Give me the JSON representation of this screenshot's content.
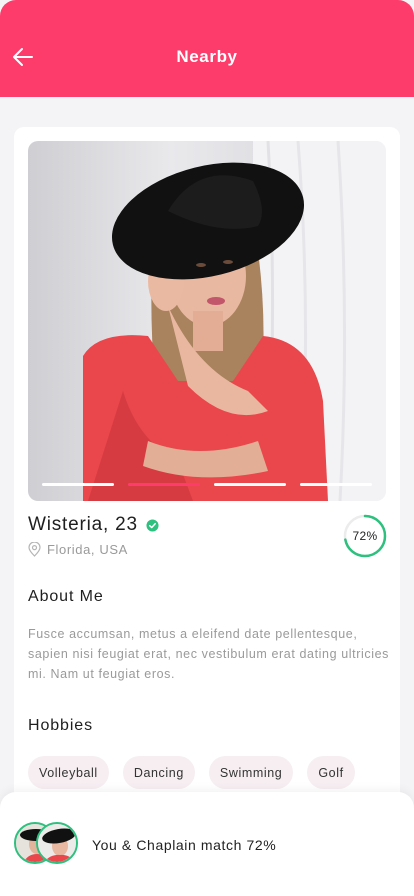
{
  "header": {
    "title": "Nearby",
    "back_icon": "arrow-left-icon",
    "background": "#fd3c6b"
  },
  "profile": {
    "name": "Wisteria, 23",
    "verified_icon": "verified-check-icon",
    "location": "Florida, USA",
    "location_icon": "map-pin-icon",
    "match_percent": 72,
    "match_label": "72%",
    "photo_pages": 4,
    "active_page": 2
  },
  "about": {
    "title": "About Me",
    "text": "Fusce accumsan, metus a eleifend date pellentesque, sapien nisi feugiat erat, nec vestibulum erat dating ultricies mi. Nam ut feugiat eros."
  },
  "hobbies": {
    "title": "Hobbies",
    "items": [
      "Volleyball",
      "Dancing",
      "Swimming",
      "Golf"
    ]
  },
  "match_bar": {
    "text": "You & Chaplain match 72%"
  },
  "colors": {
    "accent": "#fd3c6b",
    "success": "#2ec07f",
    "chip": "#f6eef1"
  }
}
